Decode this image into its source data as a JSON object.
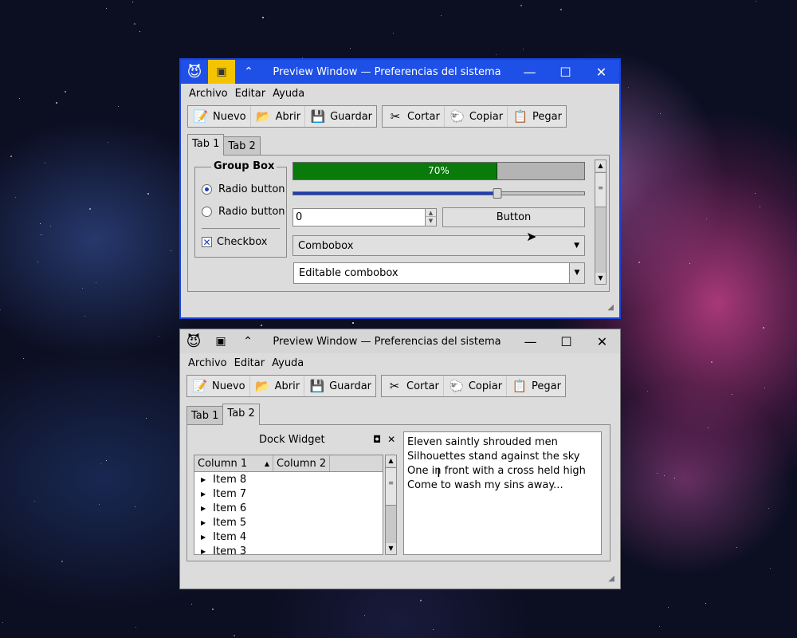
{
  "window_top": {
    "title": "Preview Window — Preferencias del sistema",
    "app_icon": "beastie-mascot-icon",
    "menu": [
      "Archivo",
      "Editar",
      "Ayuda"
    ],
    "toolbar": {
      "file_group": [
        {
          "label": "Nuevo",
          "icon": "new-document-icon"
        },
        {
          "label": "Abrir",
          "icon": "open-folder-icon"
        },
        {
          "label": "Guardar",
          "icon": "floppy-disk-icon"
        }
      ],
      "edit_group": [
        {
          "label": "Cortar",
          "icon": "scissors-icon"
        },
        {
          "label": "Copiar",
          "icon": "sheep-icon"
        },
        {
          "label": "Pegar",
          "icon": "clipboard-icon"
        }
      ]
    },
    "tabs": [
      "Tab 1",
      "Tab 2"
    ],
    "active_tab": "Tab 1",
    "group_box": {
      "title": "Group Box",
      "radio1": "Radio button",
      "radio2": "Radio button",
      "radio1_checked": true,
      "checkbox": "Checkbox",
      "checkbox_checked": true
    },
    "progress": {
      "value": 0.7,
      "label": "70%"
    },
    "slider": {
      "value": 0.7
    },
    "spinbox_value": "0",
    "button_label": "Button",
    "combobox_value": "Combobox",
    "editable_combobox_value": "Editable combobox"
  },
  "window_bottom": {
    "title": "Preview Window — Preferencias del sistema",
    "menu": [
      "Archivo",
      "Editar",
      "Ayuda"
    ],
    "toolbar": {
      "file_group": [
        {
          "label": "Nuevo",
          "icon": "new-document-icon"
        },
        {
          "label": "Abrir",
          "icon": "open-folder-icon"
        },
        {
          "label": "Guardar",
          "icon": "floppy-disk-icon"
        }
      ],
      "edit_group": [
        {
          "label": "Cortar",
          "icon": "scissors-icon"
        },
        {
          "label": "Copiar",
          "icon": "sheep-icon"
        },
        {
          "label": "Pegar",
          "icon": "clipboard-icon"
        }
      ]
    },
    "tabs": [
      "Tab 1",
      "Tab 2"
    ],
    "active_tab": "Tab 2",
    "dock_title": "Dock Widget",
    "tree": {
      "columns": [
        "Column 1",
        "Column 2"
      ],
      "items": [
        "Item 8",
        "Item 7",
        "Item 6",
        "Item 5",
        "Item 4",
        "Item 3"
      ]
    },
    "text_lines": [
      "Eleven saintly shrouded men",
      "Silhouettes stand against the sky",
      "One in front with a cross held high",
      "Come to wash my sins away..."
    ]
  },
  "colors": {
    "active_titlebar": "#1e4fe6",
    "shade_button": "#f4c400",
    "progress_fill": "#0a7a0a",
    "accent_blue": "#1d3cb8"
  }
}
